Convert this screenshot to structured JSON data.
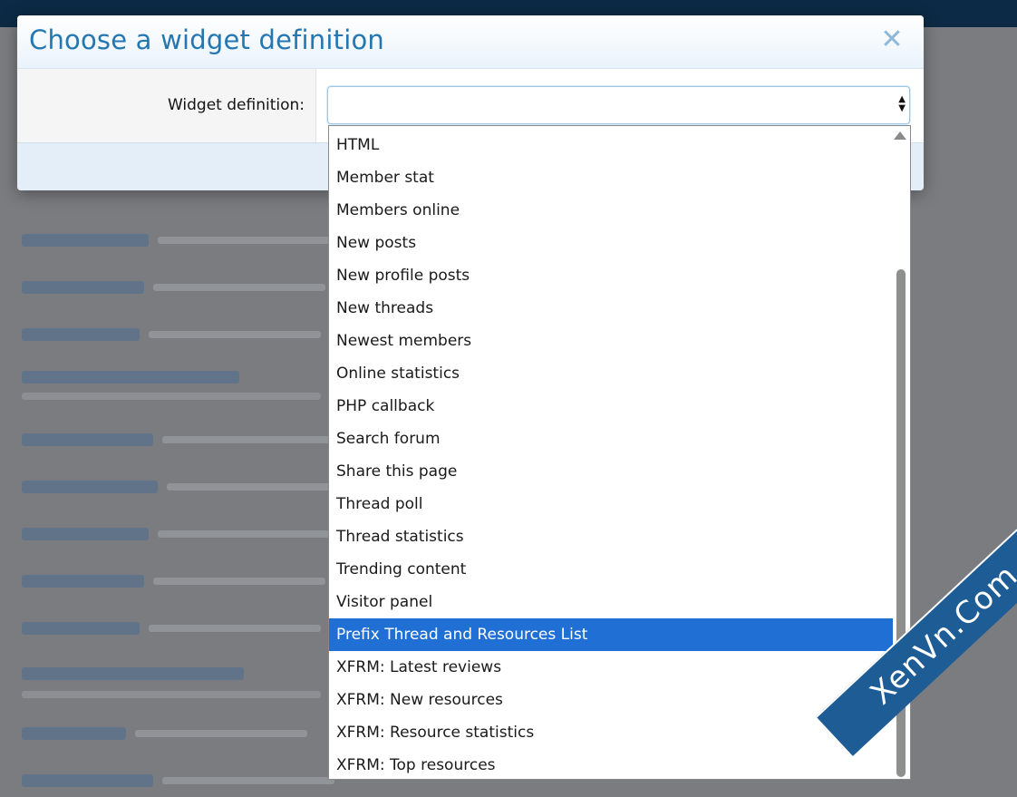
{
  "dialog": {
    "title": "Choose a widget definition",
    "close_glyph": "✕",
    "field_label": "Widget definition:",
    "select_value": ""
  },
  "dropdown": {
    "options": [
      "HTML",
      "Member stat",
      "Members online",
      "New posts",
      "New profile posts",
      "New threads",
      "Newest members",
      "Online statistics",
      "PHP callback",
      "Search forum",
      "Share this page",
      "Thread poll",
      "Thread statistics",
      "Trending content",
      "Visitor panel",
      "Prefix Thread and Resources List",
      "XFRM: Latest reviews",
      "XFRM: New resources",
      "XFRM: Resource statistics",
      "XFRM: Top resources"
    ],
    "selected_index": 15
  },
  "icons": {
    "close": "close-icon",
    "select": "select-arrows-icon",
    "scroll": "scroll-up-arrow-icon"
  },
  "colors": {
    "title": "#2577b1",
    "selected_option": "#1f6fd5",
    "watermark": "#1e5c96"
  },
  "watermark": {
    "text": "XenVn.Com"
  }
}
